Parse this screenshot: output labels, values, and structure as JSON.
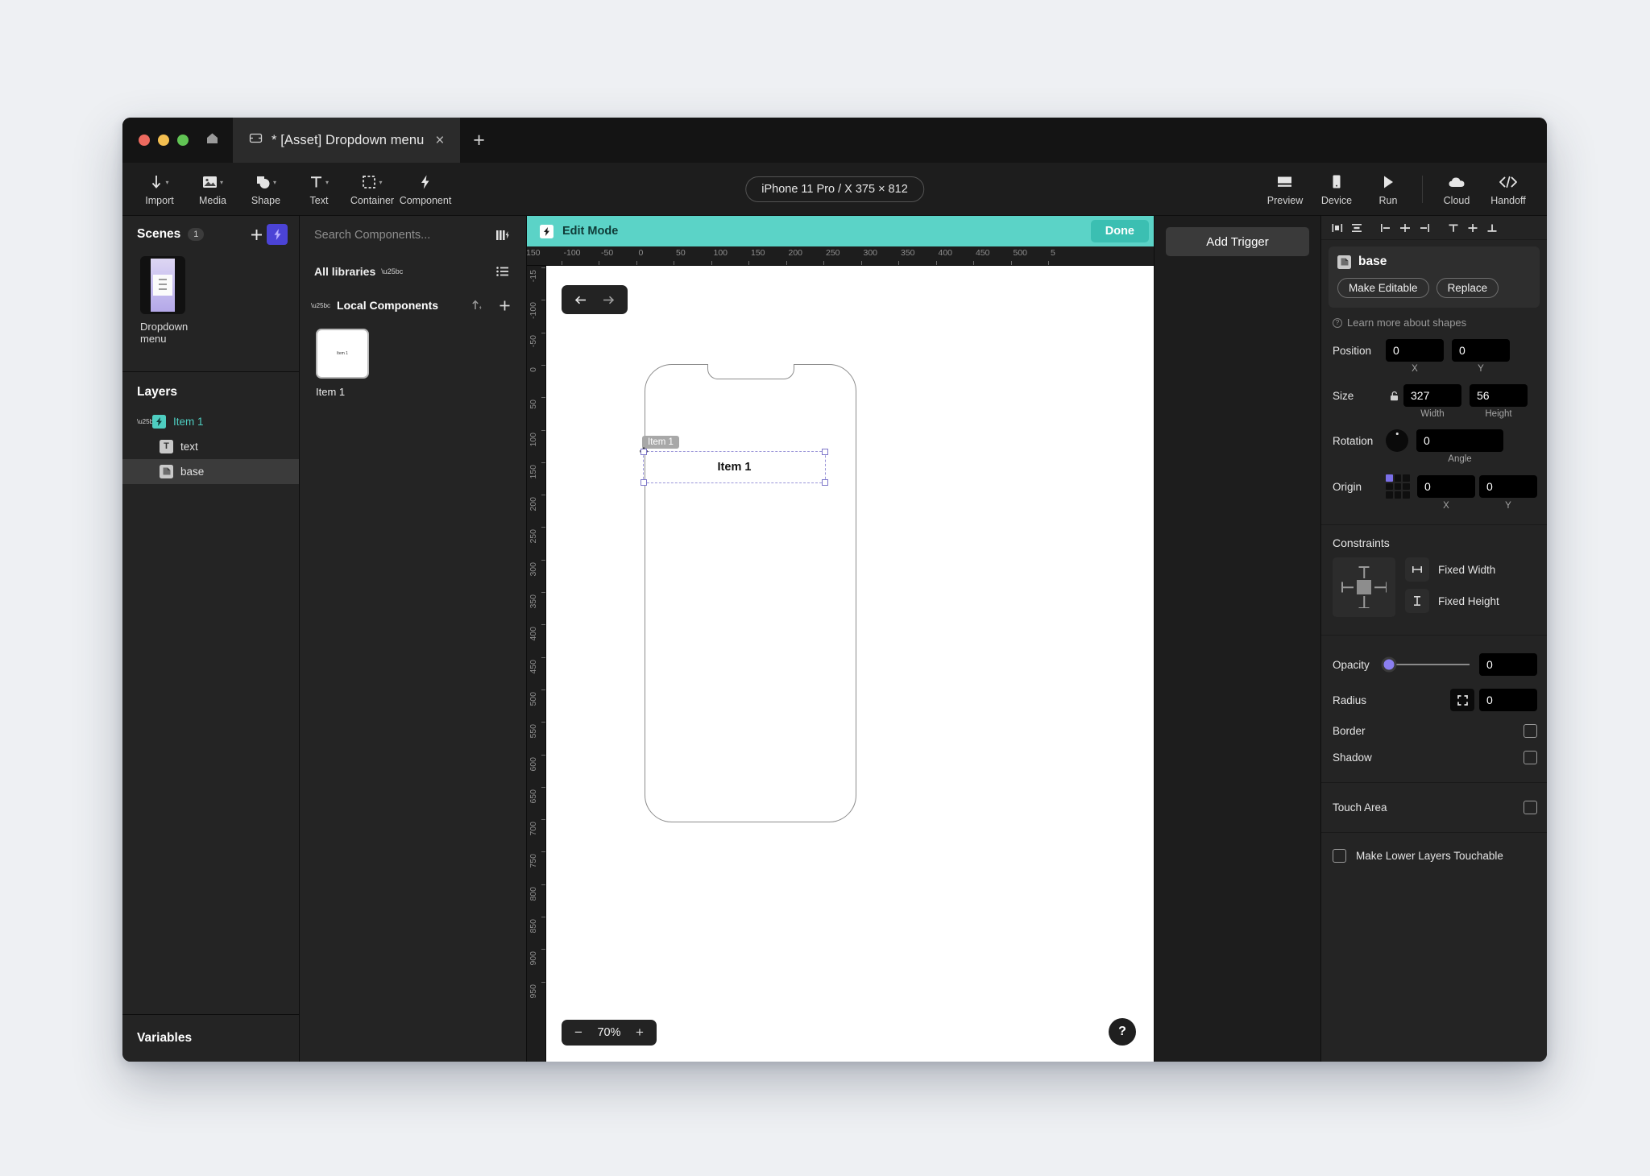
{
  "window": {
    "tab": {
      "title": "* [Asset] Dropdown menu",
      "close": "×",
      "icon": "file-icon"
    },
    "new_tab": "+",
    "home_icon": "home-icon"
  },
  "toolbar": {
    "tools": [
      {
        "label": "Import",
        "icon": "import-arrow-icon",
        "caret": true
      },
      {
        "label": "Media",
        "icon": "image-icon",
        "caret": true
      },
      {
        "label": "Shape",
        "icon": "shape-icon",
        "caret": true
      },
      {
        "label": "Text",
        "icon": "text-t-icon",
        "caret": true
      },
      {
        "label": "Container",
        "icon": "container-dashed-icon",
        "caret": true
      },
      {
        "label": "Component",
        "icon": "lightning-icon",
        "caret": false
      }
    ],
    "device": "iPhone 11 Pro / X  375 × 812",
    "right_tools": [
      {
        "label": "Preview",
        "icon": "preview-icon"
      },
      {
        "label": "Device",
        "icon": "device-icon"
      },
      {
        "label": "Run",
        "icon": "play-icon"
      },
      {
        "label": "Cloud",
        "icon": "cloud-icon"
      },
      {
        "label": "Handoff",
        "icon": "code-brackets-icon"
      }
    ]
  },
  "scenes": {
    "title": "Scenes",
    "count": "1",
    "add_label": "+",
    "items": [
      {
        "name": "Dropdown\nmenu",
        "name_line1": "Dropdown",
        "name_line2": "menu"
      }
    ]
  },
  "layers": {
    "title": "Layers",
    "items": [
      {
        "name": "Item 1",
        "type": "component",
        "selected": false,
        "indent": 0
      },
      {
        "name": "text",
        "type": "text",
        "selected": false,
        "indent": 1
      },
      {
        "name": "base",
        "type": "shape",
        "selected": true,
        "indent": 1
      }
    ]
  },
  "variables": {
    "title": "Variables"
  },
  "components": {
    "search_placeholder": "Search Components...",
    "search_value": "",
    "libraries_label": "All libraries",
    "group_label": "Local Components",
    "items": [
      {
        "name": "Item 1",
        "thumb_text": "Item 1"
      }
    ]
  },
  "edit_mode": {
    "label": "Edit Mode",
    "done": "Done"
  },
  "trigger": {
    "add_label": "Add Trigger"
  },
  "canvas": {
    "zoom": "70%",
    "zoom_out": "−",
    "zoom_in": "+",
    "help": "?",
    "nav_back": "←",
    "nav_forward": "→",
    "selection_label": "Item 1",
    "selection_caption": "Item 1",
    "ruler_h": [
      "150",
      "-100",
      "-50",
      "0",
      "50",
      "100",
      "150",
      "200",
      "250",
      "300",
      "350",
      "400",
      "450",
      "500",
      "5"
    ],
    "ruler_v": [
      "-15",
      "-100",
      "-50",
      "0",
      "50",
      "100",
      "150",
      "200",
      "250",
      "300",
      "350",
      "400",
      "450",
      "500",
      "550",
      "600",
      "650",
      "700",
      "750",
      "800",
      "850",
      "900",
      "950"
    ]
  },
  "properties": {
    "object_name": "base",
    "make_editable": "Make Editable",
    "replace": "Replace",
    "learn_more": "Learn more about shapes",
    "position": {
      "label": "Position",
      "x": "0",
      "y": "0",
      "x_label": "X",
      "y_label": "Y"
    },
    "size": {
      "label": "Size",
      "width": "327",
      "height": "56",
      "width_label": "Width",
      "height_label": "Height"
    },
    "rotation": {
      "label": "Rotation",
      "angle": "0",
      "angle_label": "Angle"
    },
    "origin": {
      "label": "Origin",
      "x": "0",
      "y": "0",
      "x_label": "X",
      "y_label": "Y"
    },
    "constraints": {
      "label": "Constraints",
      "fixed_width": "Fixed Width",
      "fixed_height": "Fixed Height"
    },
    "opacity": {
      "label": "Opacity",
      "value": "0"
    },
    "radius": {
      "label": "Radius",
      "value": "0"
    },
    "border": {
      "label": "Border",
      "checked": false
    },
    "shadow": {
      "label": "Shadow",
      "checked": false
    },
    "touch_area": {
      "label": "Touch Area",
      "checked": false
    },
    "make_lower_layers": {
      "label": "Make Lower Layers Touchable",
      "checked": false
    }
  },
  "colors": {
    "accent_teal": "#5bd3c7",
    "accent_purple": "#7b6fe8",
    "panel_bg": "#242424",
    "window_bg": "#1d1d1d",
    "selection": "#9a95d8"
  }
}
